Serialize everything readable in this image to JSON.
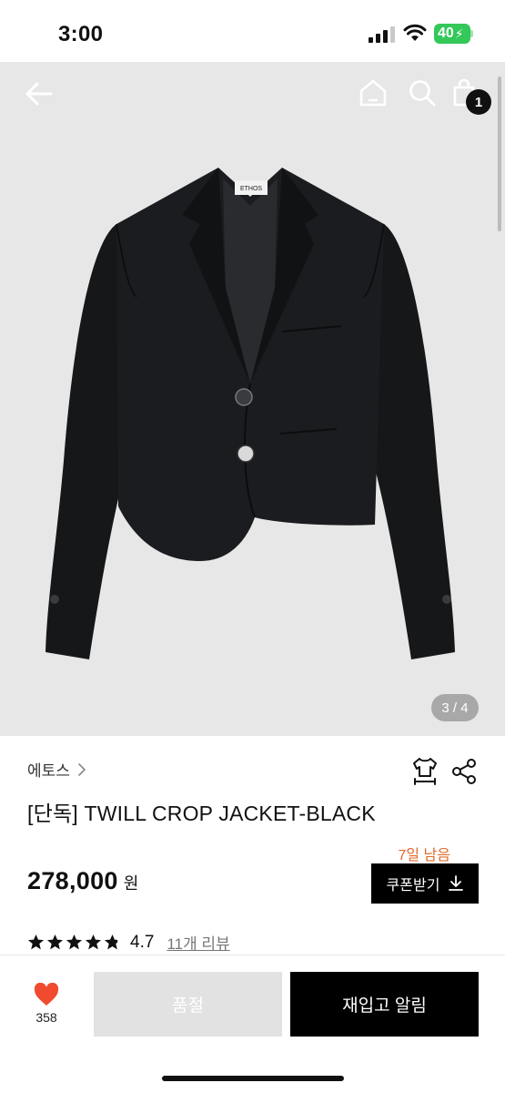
{
  "status_bar": {
    "time": "3:00",
    "battery": "40"
  },
  "gallery": {
    "page_indicator": "3 / 4",
    "cart_count": "1",
    "jacket_label": "ETHOS"
  },
  "product": {
    "brand": "에토스",
    "title": "[단독] TWILL CROP JACKET-BLACK",
    "deadline": "7일 남음",
    "price": "278,000",
    "price_unit": "원",
    "coupon_label": "쿠폰받기",
    "rating": "4.7",
    "rating_stars": 4.7,
    "review_link": "11개 리뷰"
  },
  "bottom_bar": {
    "like_count": "358",
    "soldout_label": "품절",
    "restock_label": "재입고 알림"
  },
  "colors": {
    "accent_orange": "#e06a2a",
    "heart": "#f04b2e",
    "battery_green": "#34c759"
  }
}
